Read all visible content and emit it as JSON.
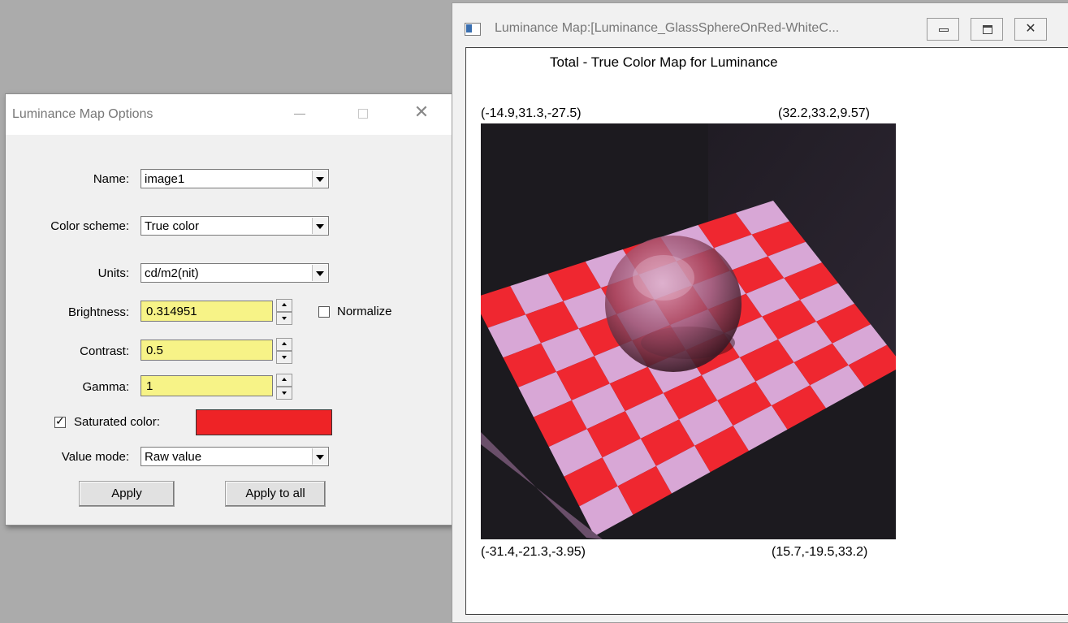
{
  "options_dialog": {
    "title": "Luminance Map Options",
    "close_glyph": "✕",
    "name": {
      "label": "Name:",
      "value": "image1"
    },
    "color_scheme": {
      "label": "Color scheme:",
      "value": "True color"
    },
    "units": {
      "label": "Units:",
      "value": "cd/m2(nit)"
    },
    "brightness": {
      "label": "Brightness:",
      "value": "0.314951"
    },
    "normalize": {
      "label": "Normalize",
      "checked": false
    },
    "contrast": {
      "label": "Contrast:",
      "value": "0.5"
    },
    "gamma": {
      "label": "Gamma:",
      "value": "1"
    },
    "saturated_color": {
      "label": "Saturated color:",
      "checked": true,
      "color": "#ee2326"
    },
    "value_mode": {
      "label": "Value mode:",
      "value": "Raw value"
    },
    "apply_label": "Apply",
    "apply_all_label": "Apply to all"
  },
  "map_window": {
    "title": "Luminance Map:[Luminance_GlassSphereOnRed-WhiteC...",
    "close_glyph": "✕",
    "map_title": "Total - True Color Map for Luminance",
    "coords": {
      "top_left": "(-14.9,31.3,-27.5)",
      "top_right": "(32.2,33.2,9.57)",
      "bottom_left": "(-31.4,-21.3,-3.95)",
      "bottom_right": "(15.7,-19.5,33.2)"
    },
    "scene": {
      "background": "#1c1a1f",
      "wall_right": "#2a2430",
      "tile_red": "#ef2730",
      "tile_light": "#d8a7d6",
      "sphere_tint": "#b56a8a"
    }
  }
}
